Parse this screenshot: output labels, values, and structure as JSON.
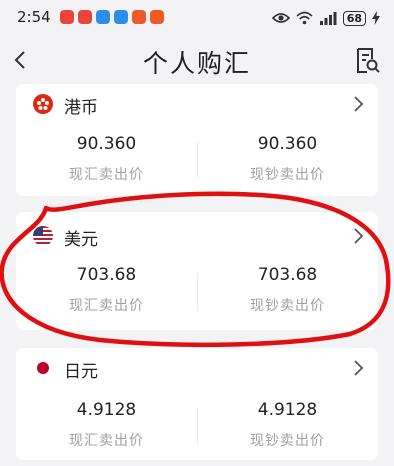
{
  "status_bar": {
    "time": "2:54",
    "battery": "68",
    "app_icons": [
      "#e8453c",
      "#e8453c",
      "#2b8fe8",
      "#2b8fe8",
      "#f0592a",
      "#f0592a"
    ]
  },
  "nav": {
    "title": "个人购汇",
    "back_icon": "back-chevron-icon",
    "record_icon": "document-search-icon"
  },
  "currencies": [
    {
      "name": "港币",
      "flag": "hong-kong-flag-icon",
      "cash_rate": "90.360",
      "cash_label": "现汇卖出价",
      "note_rate": "90.360",
      "note_label": "现钞卖出价"
    },
    {
      "name": "美元",
      "flag": "us-flag-icon",
      "cash_rate": "703.68",
      "cash_label": "现汇卖出价",
      "note_rate": "703.68",
      "note_label": "现钞卖出价"
    },
    {
      "name": "日元",
      "flag": "japan-flag-icon",
      "cash_rate": "4.9128",
      "cash_label": "现汇卖出价",
      "note_rate": "4.9128",
      "note_label": "现钞卖出价"
    }
  ],
  "colors": {
    "background": "#f3f3f5",
    "annotation": "#e01010",
    "hk_red": "#de2910",
    "jp_red": "#bc002d"
  }
}
